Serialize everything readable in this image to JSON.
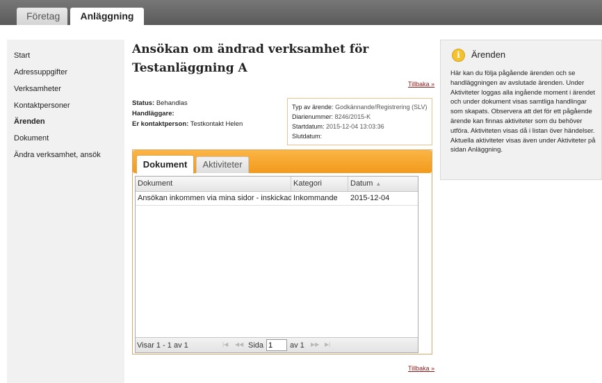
{
  "top_tabs": [
    {
      "label": "Företag"
    },
    {
      "label": "Anläggning"
    }
  ],
  "sidebar": {
    "items": [
      {
        "label": "Start"
      },
      {
        "label": "Adressuppgifter"
      },
      {
        "label": "Verksamheter"
      },
      {
        "label": "Kontaktpersoner"
      },
      {
        "label": "Ärenden"
      },
      {
        "label": "Dokument"
      },
      {
        "label": "Ändra verksamhet, ansök"
      }
    ]
  },
  "main": {
    "title_line1": "Ansökan om ändrad verksamhet för",
    "title_line2": "Testanläggning A",
    "back_link": "Tillbaka »",
    "status_label": "Status:",
    "status_value": "Behandlas",
    "handlaggare_label": "Handläggare:",
    "contact_label": "Er kontaktperson:",
    "contact_value": "Testkontakt Helen",
    "case": {
      "type_label": "Typ av ärende:",
      "type_value": "Godkännande/Registrering (SLV)",
      "diary_label": "Diarienummer:",
      "diary_value": "8246/2015-K",
      "start_label": "Startdatum:",
      "start_value": "2015-12-04 13:03:36",
      "end_label": "Slutdatum:"
    },
    "panel_tabs": [
      {
        "label": "Dokument"
      },
      {
        "label": "Aktiviteter"
      }
    ],
    "grid": {
      "columns": [
        "Dokument",
        "Kategori",
        "Datum"
      ],
      "rows": [
        [
          "Ansökan inkommen via mina sidor - inskickad",
          "Inkommande",
          "2015-12-04"
        ]
      ],
      "footer": {
        "records": "Visar 1 - 1 av 1",
        "page_label": "Sida",
        "page_value": "1",
        "of_label": "av 1"
      }
    }
  },
  "info": {
    "title": "Ärenden",
    "text": "Här kan du följa pågående ärenden och se handläggningen av avslutade ärenden. Under Aktiviteter loggas alla ingående moment i ärendet och under dokument visas samtliga handlingar som skapats. Observera att det för ett pågående ärende kan finnas aktiviteter som du behöver utföra. Aktiviteten visas då i listan över händelser. Aktuella aktiviteter visas även under Aktiviteter på sidan Anläggning."
  },
  "colors": {
    "accent_orange": "#f29a1b",
    "link_red": "#8a1a1a",
    "info_icon": "#f3c233"
  }
}
